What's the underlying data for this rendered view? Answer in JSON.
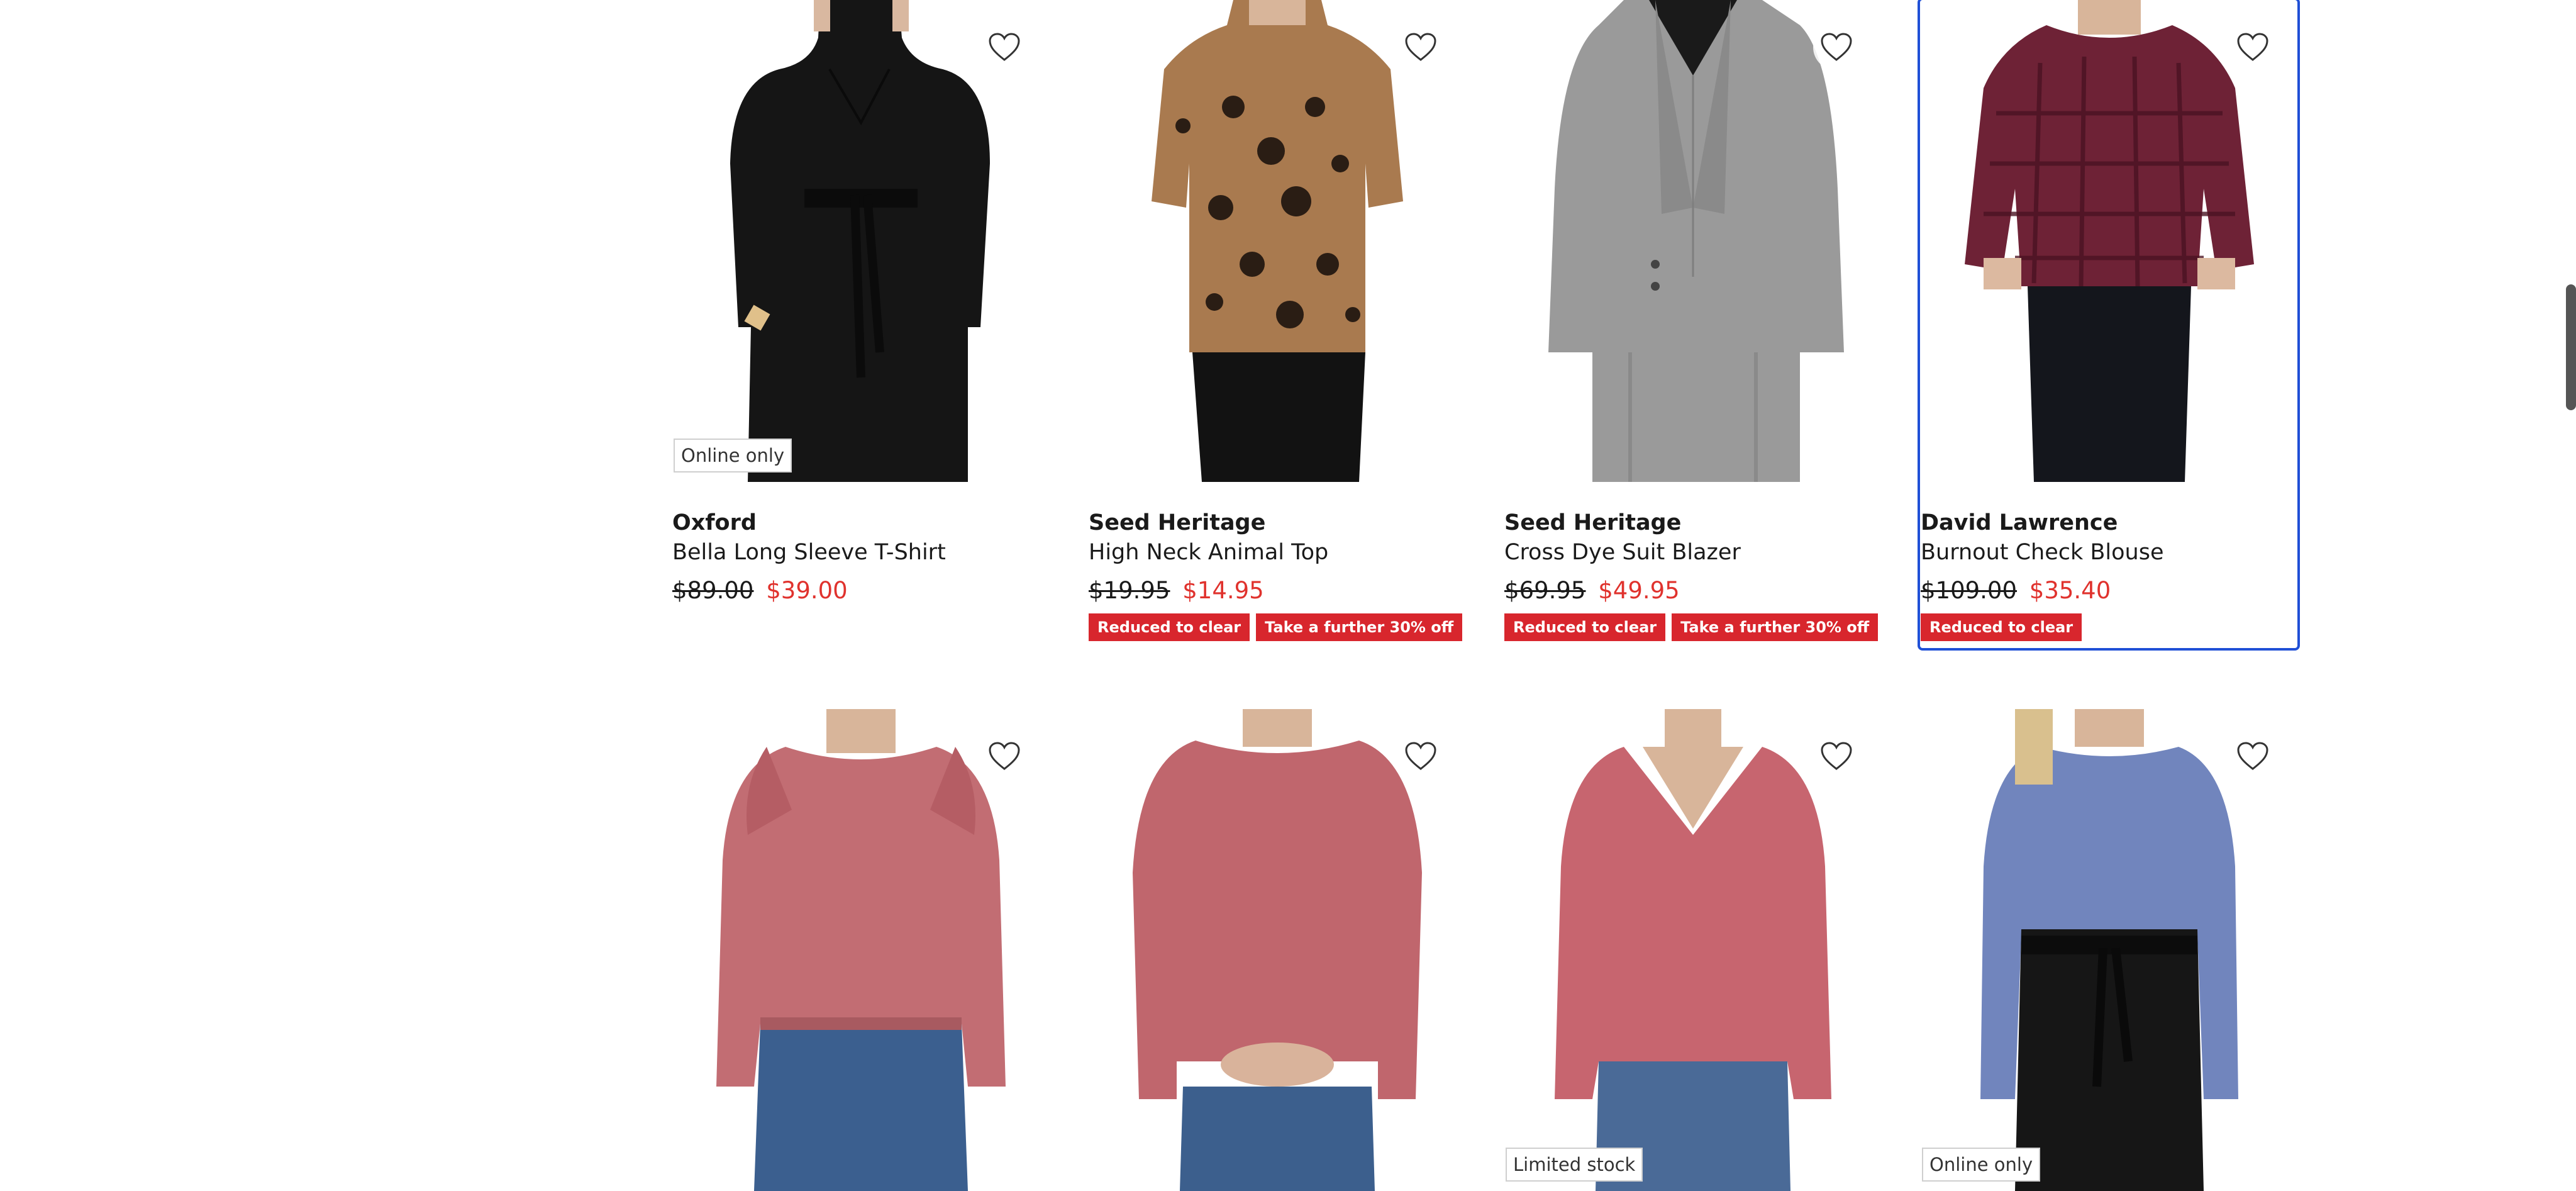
{
  "products": [
    {
      "flag": "Online only",
      "brand": "Oxford",
      "name": "Bella Long Sleeve T-Shirt",
      "was": "$89.00",
      "now": "$39.00",
      "badges": []
    },
    {
      "flag": "",
      "brand": "Seed Heritage",
      "name": "High Neck Animal Top",
      "was": "$19.95",
      "now": "$14.95",
      "badges": [
        "Reduced to clear",
        "Take a further 30% off"
      ]
    },
    {
      "flag": "",
      "brand": "Seed Heritage",
      "name": "Cross Dye Suit Blazer",
      "was": "$69.95",
      "now": "$49.95",
      "badges": [
        "Reduced to clear",
        "Take a further 30% off"
      ]
    },
    {
      "flag": "",
      "brand": "David Lawrence",
      "name": "Burnout Check Blouse",
      "was": "$109.00",
      "now": "$35.40",
      "badges": [
        "Reduced to clear"
      ]
    },
    {
      "flag": ""
    },
    {
      "flag": ""
    },
    {
      "flag": "Limited stock"
    },
    {
      "flag": "Online only"
    }
  ],
  "icons": {
    "wishlist": "heart-outline-icon"
  },
  "colors": {
    "sale_price": "#e0322d",
    "badge_bg": "#d8262d",
    "focus_ring": "#1f4fd6"
  }
}
